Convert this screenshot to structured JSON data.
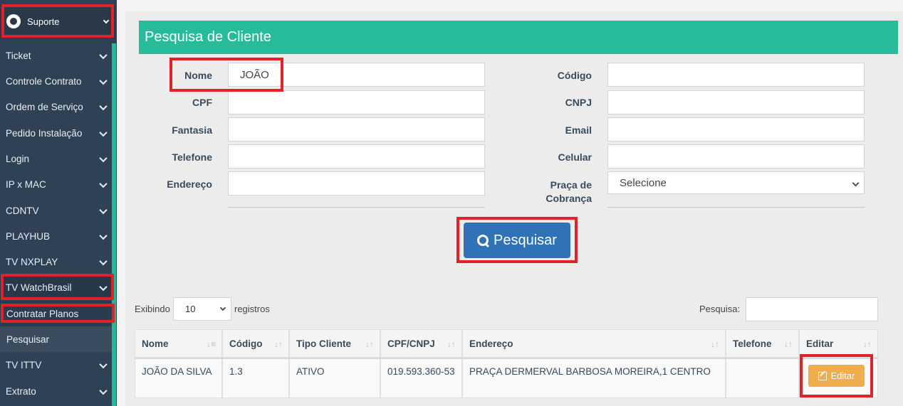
{
  "sidebar": {
    "header": "Suporte",
    "items": [
      {
        "label": "Ticket"
      },
      {
        "label": "Controle Contrato"
      },
      {
        "label": "Ordem de Serviço"
      },
      {
        "label": "Pedido Instalação"
      },
      {
        "label": "Login"
      },
      {
        "label": "IP x MAC"
      },
      {
        "label": "CDNTV"
      },
      {
        "label": "PLAYHUB"
      },
      {
        "label": "TV NXPLAY"
      },
      {
        "label": "TV WatchBrasil"
      },
      {
        "label": "TV ITTV"
      },
      {
        "label": "Extrato"
      }
    ],
    "subitems": [
      {
        "label": "Contratar Planos"
      },
      {
        "label": "Pesquisar"
      }
    ]
  },
  "form": {
    "title": "Pesquisa de Cliente",
    "left_fields": [
      {
        "label": "Nome",
        "value": "JOÃO"
      },
      {
        "label": "CPF",
        "value": ""
      },
      {
        "label": "Fantasia",
        "value": ""
      },
      {
        "label": "Telefone",
        "value": ""
      },
      {
        "label": "Endereço",
        "value": ""
      }
    ],
    "right_fields": [
      {
        "label": "Código",
        "value": ""
      },
      {
        "label": "CNPJ",
        "value": ""
      },
      {
        "label": "Email",
        "value": ""
      },
      {
        "label": "Celular",
        "value": ""
      }
    ],
    "praca_label_line1": "Praça de",
    "praca_label_line2": "Cobrança",
    "praca_value": "Selecione",
    "search_button": "Pesquisar"
  },
  "table_controls": {
    "show_prefix": "Exibindo",
    "page_length": "10",
    "show_suffix": "registros",
    "search_label": "Pesquisa:"
  },
  "table": {
    "columns": [
      "Nome",
      "Código",
      "Tipo Cliente",
      "CPF/CNPJ",
      "Endereço",
      "Telefone",
      "Editar"
    ],
    "rows": [
      {
        "nome": "JOÃO DA SILVA",
        "codigo": "1.3",
        "tipo": "ATIVO",
        "cpf": "019.593.360-53",
        "endereco": "PRAÇA DERMERVAL BARBOSA MOREIRA,1 CENTRO",
        "telefone": "",
        "edit_label": "Editar"
      }
    ]
  },
  "colors": {
    "accent": "#26bc9a",
    "sidebar": "#2f4154",
    "primary_button": "#2f72b6",
    "edit_button": "#f0ad4e",
    "highlight": "#e32128"
  }
}
